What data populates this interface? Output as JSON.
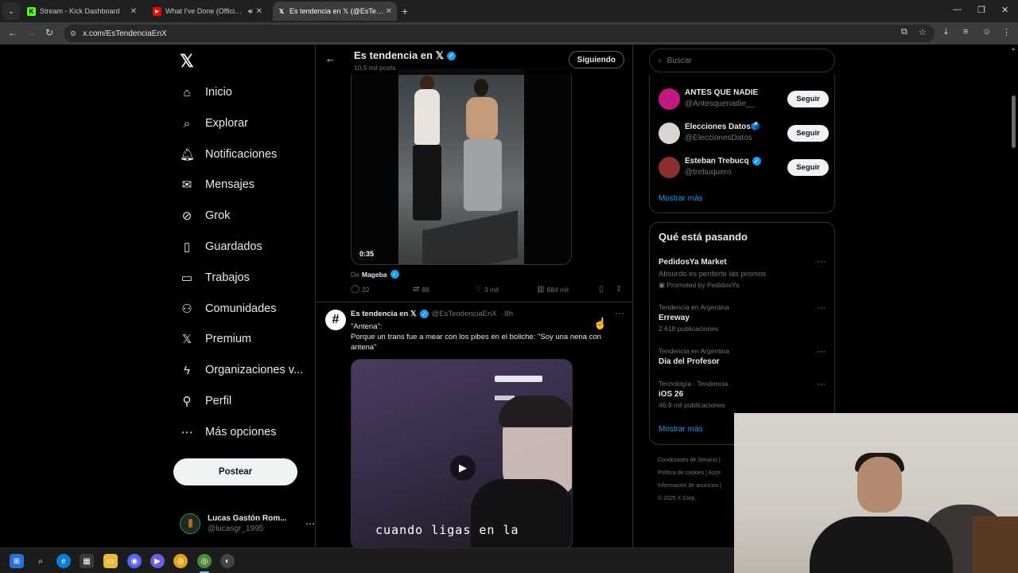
{
  "browser": {
    "tabs": [
      {
        "label": "Stream - Kick Dashboard",
        "fav": "K",
        "fav_color": "#53fc18"
      },
      {
        "label": "What I've Done (Official Mu",
        "fav": "▶",
        "fav_color": "#ff0000"
      },
      {
        "label": "Es tendencia en 𝕏 (@EsTendenc",
        "fav": "𝕏",
        "fav_color": "#ffffff"
      }
    ],
    "url": "x.com/EsTendenciaEnX"
  },
  "nav": {
    "logo": "𝕏",
    "items": [
      {
        "label": "Inicio",
        "icon": "⌂"
      },
      {
        "label": "Explorar",
        "icon": "⌕"
      },
      {
        "label": "Notificaciones",
        "icon": "🔔︎"
      },
      {
        "label": "Mensajes",
        "icon": "✉"
      },
      {
        "label": "Grok",
        "icon": "⊘"
      },
      {
        "label": "Guardados",
        "icon": "▯"
      },
      {
        "label": "Trabajos",
        "icon": "▭"
      },
      {
        "label": "Comunidades",
        "icon": "⚇"
      },
      {
        "label": "Premium",
        "icon": "𝕏"
      },
      {
        "label": "Organizaciones v...",
        "icon": "ϟ"
      },
      {
        "label": "Perfil",
        "icon": "⚲"
      },
      {
        "label": "Más opciones",
        "icon": "⋯"
      }
    ],
    "post_button": "Postear",
    "user": {
      "name": "Lucas Gastón Rom...",
      "handle": "@lucasgr_1995"
    }
  },
  "header": {
    "title": "Es tendencia en 𝕏",
    "posts": "10,5 mil posts",
    "follow_label": "Siguiendo"
  },
  "tweet1": {
    "video_time": "0:35",
    "from_prefix": "De",
    "from_name": "Mageba",
    "replies": "22",
    "reposts": "88",
    "likes": "3 mil",
    "views": "684 mil"
  },
  "tweet2": {
    "avatar": "#",
    "name": "Es tendencia en 𝕏",
    "handle": "@EsTendenciaEnX",
    "time": "· 8h",
    "line1": "\"Antena\":",
    "line2": "Porque un trans fue a mear con los pibes en el boliche: \"Soy una nena con antena\"",
    "video_caption": "cuando  ligas en la"
  },
  "search": {
    "placeholder": "Buscar"
  },
  "who_to_follow": {
    "items": [
      {
        "name": "ANTES QUE NADIE",
        "handle": "@Antesquenadie__",
        "verified": false,
        "avatar_color": "#c2187f"
      },
      {
        "name": "Elecciones Datos🗳️",
        "handle": "@EleccionesDatos",
        "verified": false,
        "avatar_color": "#d9d4cf"
      },
      {
        "name": "Esteban Trebucq",
        "handle": "@trebuquero",
        "verified": true,
        "avatar_color": "#8b2f2f"
      }
    ],
    "follow_label": "Seguir",
    "show_more": "Mostrar más"
  },
  "trends": {
    "title": "Qué está pasando",
    "items": [
      {
        "category": "",
        "name": "PedidosYa Market",
        "count": "Absurdo es perderte las promos",
        "promo": "Promoted by PedidosYa"
      },
      {
        "category": "Tendencia en Argentina",
        "name": "Erreway",
        "count": "2.618 publicaciones"
      },
      {
        "category": "Tendencia en Argentina",
        "name": "Día del Profesor",
        "count": ""
      },
      {
        "category": "Tecnología · Tendencia",
        "name": "iOS 26",
        "count": "46,9 mil publicaciones"
      }
    ],
    "show_more": "Mostrar más"
  },
  "footer": {
    "links": [
      "Condiciones de Servicio |",
      "Política de cookies | Acce",
      "Información de anuncios |",
      "© 2025 X Corp."
    ]
  }
}
